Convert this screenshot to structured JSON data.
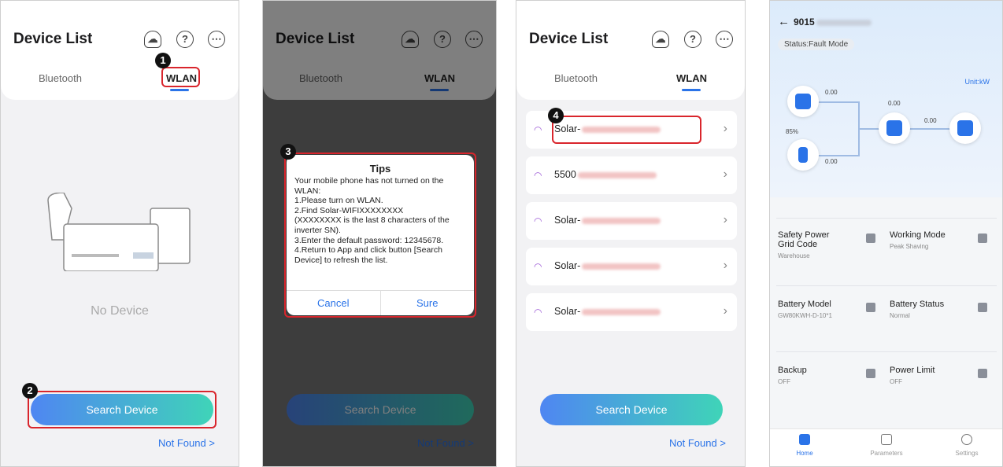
{
  "panel1": {
    "title": "Device List",
    "tab_bluetooth": "Bluetooth",
    "tab_wlan": "WLAN",
    "no_device": "No Device",
    "search_button": "Search Device",
    "not_found": "Not Found >",
    "badge1": "1",
    "badge2": "2"
  },
  "panel2": {
    "title": "Device List",
    "tab_bluetooth": "Bluetooth",
    "tab_wlan": "WLAN",
    "search_button": "Search Device",
    "not_found": "Not Found >",
    "badge": "3",
    "dialog": {
      "title": "Tips",
      "lines": [
        "Your mobile phone has not turned on the WLAN:",
        "1.Please turn on WLAN.",
        "2.Find Solar-WIFIXXXXXXXX",
        "(XXXXXXXX is the last 8 characters of the inverter SN).",
        "3.Enter the default password: 12345678.",
        "4.Return to App and click button [Search Device] to refresh the list."
      ],
      "cancel": "Cancel",
      "sure": "Sure"
    }
  },
  "panel3": {
    "title": "Device List",
    "tab_bluetooth": "Bluetooth",
    "tab_wlan": "WLAN",
    "badge": "4",
    "search_button": "Search Device",
    "not_found": "Not Found >",
    "devices": [
      {
        "name": "Solar-"
      },
      {
        "name": "5500"
      },
      {
        "name": "Solar-"
      },
      {
        "name": "Solar-"
      },
      {
        "name": "Solar-"
      }
    ]
  },
  "panel4": {
    "device_id": "9015",
    "status": "Status:Fault Mode",
    "unit": "Unit:kW",
    "values": {
      "pv": "0.00",
      "grid": "0.00",
      "load": "0.00",
      "battery": "0.00",
      "soc": "85%"
    },
    "cards": [
      {
        "label": "Safety Power Grid Code",
        "value": "Warehouse"
      },
      {
        "label": "Working Mode",
        "value": "Peak Shaving"
      },
      {
        "label": "Battery Model",
        "value": "GW80KWH-D-10*1"
      },
      {
        "label": "Battery Status",
        "value": "Normal"
      },
      {
        "label": "Backup",
        "value": "OFF"
      },
      {
        "label": "Power Limit",
        "value": "OFF"
      }
    ],
    "nav": [
      "Home",
      "Parameters",
      "Settings"
    ]
  }
}
